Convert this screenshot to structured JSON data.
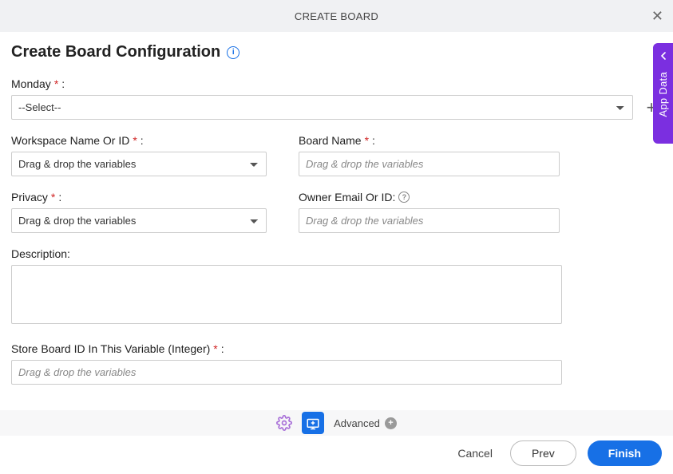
{
  "header": {
    "title": "CREATE BOARD"
  },
  "page": {
    "title": "Create Board Configuration"
  },
  "fields": {
    "monday_label": "Monday",
    "monday_selected": "--Select--",
    "workspace_label": "Workspace Name Or ID ",
    "workspace_placeholder": "Drag & drop the variables",
    "boardname_label": "Board Name",
    "boardname_placeholder": "Drag & drop the variables",
    "privacy_label": "Privacy",
    "privacy_placeholder": "Drag & drop the variables",
    "owner_label": "Owner Email Or ID: ",
    "owner_placeholder": "Drag & drop the variables",
    "description_label": "Description:",
    "store_label": "Store Board ID In This Variable (Integer)",
    "store_placeholder": "Drag & drop the variables"
  },
  "footer": {
    "advanced": "Advanced"
  },
  "actions": {
    "cancel": "Cancel",
    "prev": "Prev",
    "finish": "Finish"
  },
  "side": {
    "label": "App Data"
  }
}
